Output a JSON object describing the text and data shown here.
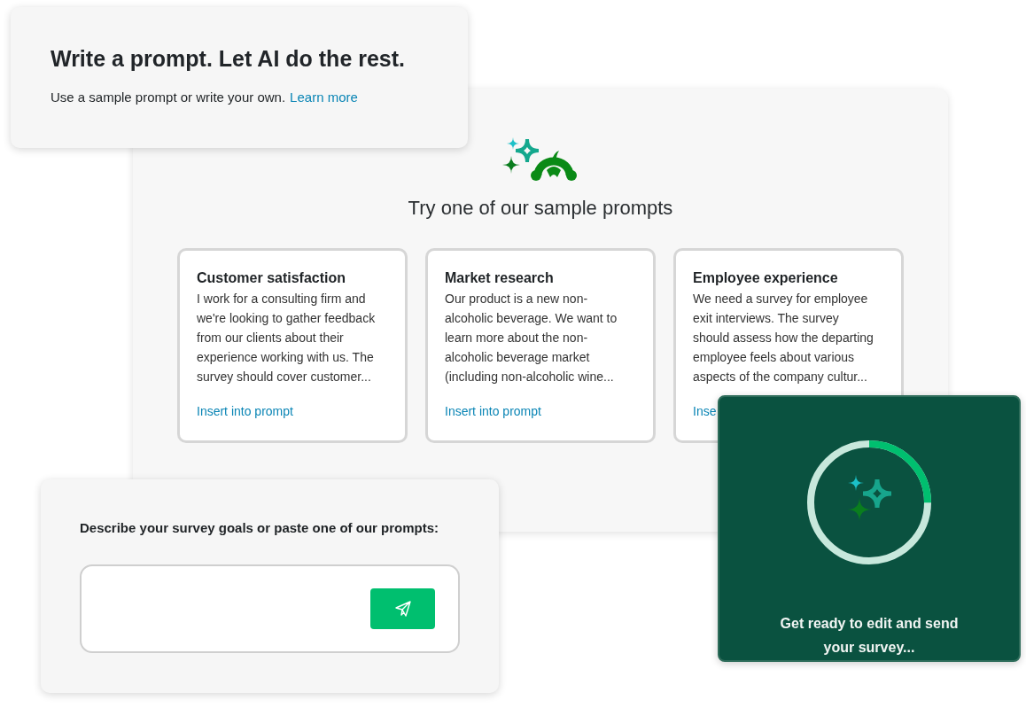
{
  "intro_card": {
    "title": "Write a prompt. Let AI do the rest.",
    "text": "Use a sample prompt or write your own.",
    "link": "Learn more"
  },
  "samples_panel": {
    "heading": "Try one of our sample prompts",
    "cards": [
      {
        "title": "Customer satisfaction",
        "lines": [
          "I work for a consulting firm and",
          "we're looking to gather feedback",
          "from our clients about their",
          "experience working with us. The",
          "survey should cover customer..."
        ],
        "link": "Insert into prompt"
      },
      {
        "title": "Market research",
        "lines": [
          "Our product is a new non-",
          "alcoholic beverage. We want to",
          "learn more about the non-",
          "alcoholic beverage market",
          "(including non-alcoholic wine..."
        ],
        "link": "Insert into prompt"
      },
      {
        "title": "Employee experience",
        "lines": [
          "We need a survey for employee",
          "exit interviews. The survey",
          "should assess how the departing",
          "employee feels about various",
          "aspects of the company cultur..."
        ],
        "link": "Inse"
      }
    ]
  },
  "prompt_card": {
    "label": "Describe your survey goals or paste one of our prompts:"
  },
  "progress_card": {
    "level": 0.25,
    "text": [
      "Get ready to edit and send",
      "your survey..."
    ]
  }
}
